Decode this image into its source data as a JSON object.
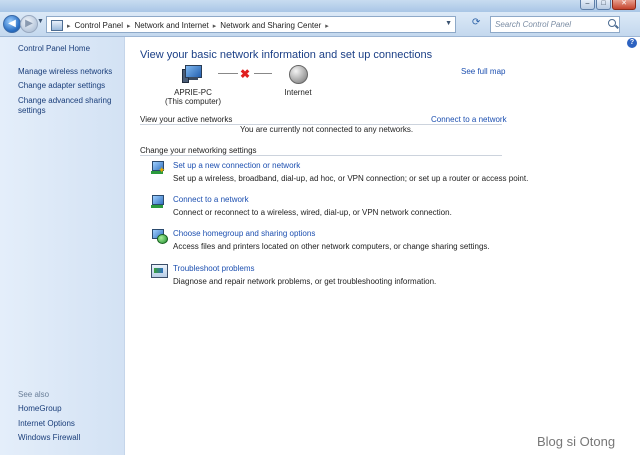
{
  "navbar": {
    "breadcrumbs": [
      "Control Panel",
      "Network and Internet",
      "Network and Sharing Center"
    ],
    "search_placeholder": "Search Control Panel"
  },
  "sidebar": {
    "home": "Control Panel Home",
    "links": [
      "Manage wireless networks",
      "Change adapter settings",
      "Change advanced sharing settings"
    ],
    "see_also_label": "See also",
    "see_also": [
      "HomeGroup",
      "Internet Options",
      "Windows Firewall"
    ]
  },
  "main": {
    "title": "View your basic network information and set up connections",
    "see_full_map": "See full map",
    "computer_name": "APRIE-PC",
    "computer_sub": "(This computer)",
    "internet_label": "Internet",
    "active_networks_label": "View your active networks",
    "active_networks_status": "You are currently not connected to any networks.",
    "connect_link": "Connect to a network",
    "change_settings_label": "Change your networking settings",
    "tasks": [
      {
        "title": "Set up a new connection or network",
        "desc": "Set up a wireless, broadband, dial-up, ad hoc, or VPN connection; or set up a router or access point."
      },
      {
        "title": "Connect to a network",
        "desc": "Connect or reconnect to a wireless, wired, dial-up, or VPN network connection."
      },
      {
        "title": "Choose homegroup and sharing options",
        "desc": "Access files and printers located on other network computers, or change sharing settings."
      },
      {
        "title": "Troubleshoot problems",
        "desc": "Diagnose and repair network problems, or get troubleshooting information."
      }
    ]
  },
  "watermark": "Blog si Otong",
  "colors": {
    "link": "#1c4fb0",
    "sidebar_bg": "#dce8f7",
    "title": "#1b3f86"
  }
}
